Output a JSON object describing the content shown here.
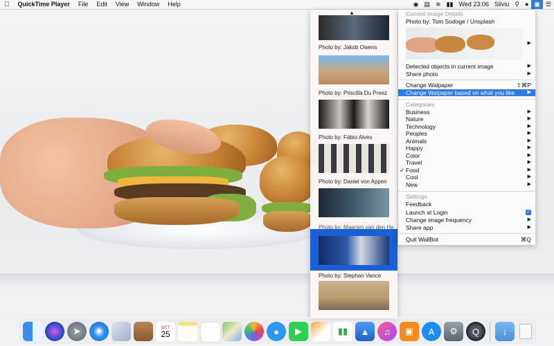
{
  "menubar": {
    "apple": "",
    "app": "QuickTime Player",
    "items": [
      "File",
      "Edit",
      "View",
      "Window",
      "Help"
    ],
    "clock": "Wed 23:06",
    "user": "Silviu"
  },
  "strip": {
    "captions": [
      "Photo by: Jakob Owens",
      "Photo by: Priscilla Du Preez",
      "Photo by: Fábio  Alves",
      "Photo by: Daniel von Appen",
      "Photo by: Maarten van den He",
      "Photo by: Stephan Vance"
    ]
  },
  "menu": {
    "current_header": "Current Image Details",
    "photo_by": "Photo by: Tom Sodoge / Unsplash",
    "detected": "Detected objects in current image",
    "share_photo": "Share photo",
    "change_wallpaper": "Change Walpaper",
    "change_wallpaper_shortcut": "⇧⌘P",
    "change_based": "Change Walpaper based on what you like",
    "categories_header": "Categories",
    "categories": [
      "Business",
      "Nature",
      "Technology",
      "Peoples",
      "Animals",
      "Happy",
      "Color",
      "Travel",
      "Food",
      "Cool",
      "New"
    ],
    "checked_category": "Food",
    "settings_header": "Settings",
    "feedback": "Feedback",
    "launch_login": "Launch at Login",
    "image_frequency": "Change image frequency",
    "share_app": "Share app",
    "quit": "Quit WallBot",
    "quit_shortcut": "⌘Q"
  },
  "colors": {
    "highlight": "#2f7ae5",
    "selected_thumb": "#1a5fd6"
  },
  "dock": {
    "icons": [
      "finder-icon",
      "siri-icon",
      "launchpad-icon",
      "safari-icon",
      "mail-stamp-icon",
      "contacts-icon",
      "calendar-icon",
      "notes-icon",
      "reminders-icon",
      "maps-icon",
      "photos-icon",
      "messages-icon",
      "facetime-icon",
      "pages-icon",
      "numbers-icon",
      "keynote-icon",
      "itunes-icon",
      "ibooks-icon",
      "appstore-icon",
      "preferences-icon",
      "quicktime-icon",
      "downloads-icon",
      "trash-icon"
    ],
    "calendar_month": "OCT",
    "calendar_day": "25"
  }
}
